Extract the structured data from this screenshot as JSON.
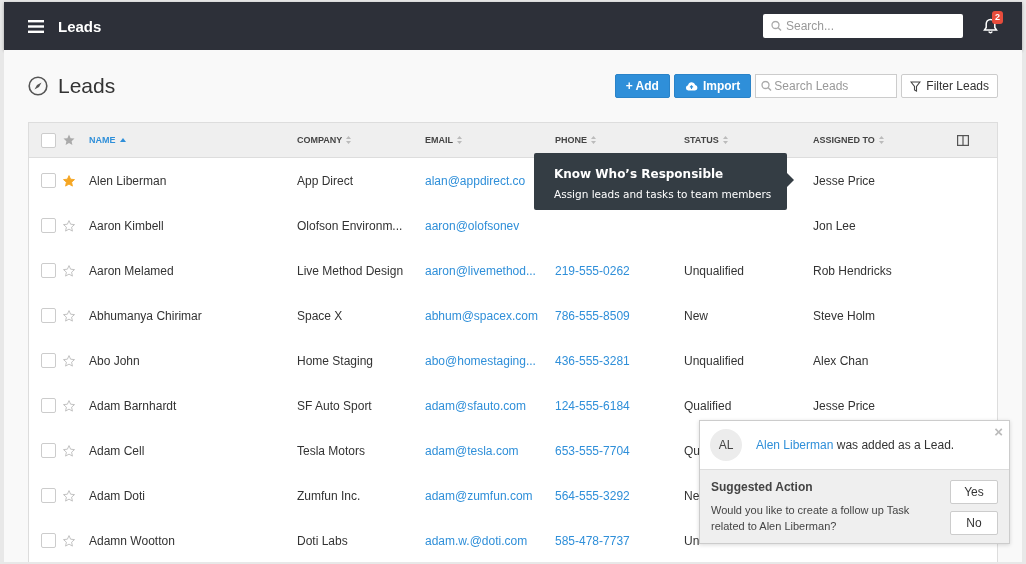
{
  "topbar": {
    "title": "Leads",
    "search": {
      "placeholder": "Search..."
    },
    "notifications": "2"
  },
  "page": {
    "title": "Leads",
    "add_button": "+ Add",
    "import_button": "Import",
    "search": {
      "placeholder": "Search Leads"
    },
    "filter_button": "Filter Leads"
  },
  "table": {
    "all_selected": false,
    "columns": [
      {
        "label": "NAME",
        "sorted": true
      },
      {
        "label": "COMPANY",
        "sorted": false
      },
      {
        "label": "EMAIL",
        "sorted": false
      },
      {
        "label": "PHONE",
        "sorted": false
      },
      {
        "label": "STATUS",
        "sorted": false
      },
      {
        "label": "ASSIGNED TO",
        "sorted": false
      }
    ],
    "rows": [
      {
        "starred": true,
        "selected": false,
        "name": "Alen Liberman",
        "company": "App Direct",
        "email": "alan@appdirect.co",
        "assigned": "Jesse Price"
      },
      {
        "starred": false,
        "selected": false,
        "name": "Aaron Kimbell",
        "company": "Olofson Environm...",
        "email": "aaron@olofsonev",
        "assigned": "Jon Lee"
      },
      {
        "starred": false,
        "selected": false,
        "name": "Aaron Melamed",
        "company": "Live Method Design",
        "email": "aaron@livemethod...",
        "phone": "219-555-0262",
        "status": "Unqualified",
        "assigned": "Rob Hendricks"
      },
      {
        "starred": false,
        "selected": false,
        "name": "Abhumanya Chirimar",
        "company": "Space X",
        "email": "abhum@spacex.com",
        "phone": "786-555-8509",
        "status": "New",
        "assigned": "Steve Holm"
      },
      {
        "starred": false,
        "selected": false,
        "name": "Abo John",
        "company": "Home Staging",
        "email": "abo@homestaging...",
        "phone": "436-555-3281",
        "status": "Unqualified",
        "assigned": "Alex Chan"
      },
      {
        "starred": false,
        "selected": false,
        "name": "Adam Barnhardt",
        "company": "SF Auto Sport",
        "email": "adam@sfauto.com",
        "phone": "124-555-6184",
        "status": "Qualified",
        "assigned": "Jesse Price"
      },
      {
        "starred": false,
        "selected": false,
        "name": "Adam Cell",
        "company": "Tesla Motors",
        "email": "adam@tesla.com",
        "phone": "653-555-7704",
        "status": "Qu"
      },
      {
        "starred": false,
        "selected": false,
        "name": "Adam Doti",
        "company": "Zumfun Inc.",
        "email": "adam@zumfun.com",
        "phone": "564-555-3292",
        "status": "Ne"
      },
      {
        "starred": false,
        "selected": false,
        "name": "Adamn Wootton",
        "company": "Doti Labs",
        "email": "adam.w.@doti.com",
        "phone": "585-478-7737",
        "status": "Un"
      }
    ]
  },
  "tooltip": {
    "title": "Know Who’s Responsible",
    "text": "Assign leads and tasks to team members"
  },
  "toast": {
    "avatar": "AL",
    "link": "Alen Liberman",
    "message": " was added as a Lead.",
    "close": "×",
    "suggestion_title": "Suggested Action",
    "suggestion_text": "Would you like to create a follow up Task related to Alen Liberman?",
    "yes_button": "Yes",
    "no_button": "No"
  }
}
